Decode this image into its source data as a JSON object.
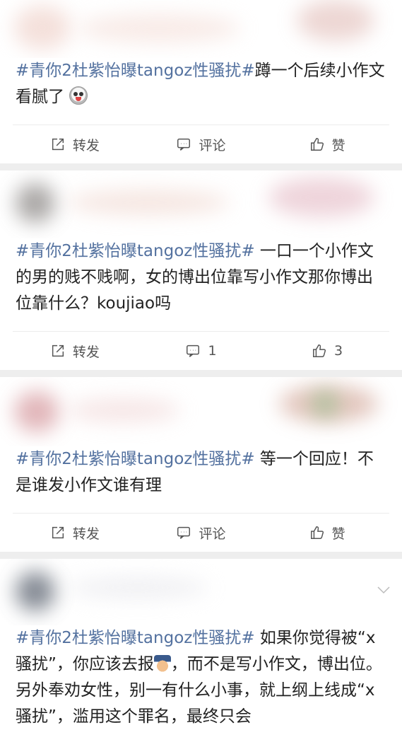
{
  "posts": [
    {
      "tag": "#青你2杜紫怡曝tangoz性骚扰#",
      "text": "蹲一个后续小作文看腻了",
      "emoji": "shocked-face-emoji",
      "repost_label": "转发",
      "comment_label": "评论",
      "like_label": "赞"
    },
    {
      "tag": "#青你2杜紫怡曝tangoz性骚扰#",
      "text": " 一口一个小作文的男的贱不贱啊，女的博出位靠写小作文那你博出位靠什么？koujiao吗",
      "repost_label": "转发",
      "comment_label": "1",
      "like_label": "3"
    },
    {
      "tag": "#青你2杜紫怡曝tangoz性骚扰#",
      "text": " 等一个回应！不是谁发小作文谁有理",
      "repost_label": "转发",
      "comment_label": "评论",
      "like_label": "赞"
    },
    {
      "tag": "#青你2杜紫怡曝tangoz性骚扰#",
      "text_before_emoji": " 如果你觉得被“x骚扰”，你应该去报",
      "emoji": "police-officer-emoji",
      "text_after_emoji": "，而不是写小作文，博出位。 另外奉劝女性，别一有什么小事，就上纲上线成“x骚扰”，滥用这个罪名，最终只会"
    }
  ],
  "colors": {
    "hashtag": "#53719f",
    "separator": "#eeeeee",
    "action_text": "#555555"
  }
}
